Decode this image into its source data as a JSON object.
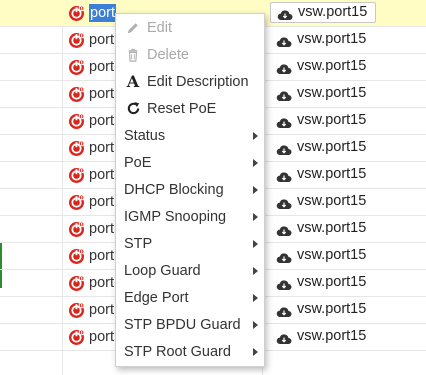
{
  "rows": [
    {
      "port": "port",
      "selected": true,
      "vsw": "vsw.port15"
    },
    {
      "port": "port",
      "vsw": "vsw.port15"
    },
    {
      "port": "port",
      "vsw": "vsw.port15"
    },
    {
      "port": "port",
      "vsw": "vsw.port15"
    },
    {
      "port": "port",
      "vsw": "vsw.port15"
    },
    {
      "port": "port",
      "vsw": "vsw.port15"
    },
    {
      "port": "port",
      "vsw": "vsw.port15"
    },
    {
      "port": "port",
      "vsw": "vsw.port15"
    },
    {
      "port": "port",
      "vsw": "vsw.port15"
    },
    {
      "port": "port",
      "vsw": "vsw.port15"
    },
    {
      "port": "port",
      "vsw": "vsw.port15"
    },
    {
      "port": "port",
      "vsw": "vsw.port15"
    },
    {
      "port": "port",
      "vsw": "vsw.port15"
    }
  ],
  "menu": {
    "items": [
      {
        "label": "Edit",
        "icon": "pencil-icon",
        "disabled": true
      },
      {
        "label": "Delete",
        "icon": "trash-icon",
        "disabled": true
      },
      {
        "label": "Edit Description",
        "icon": "text-icon"
      },
      {
        "label": "Reset PoE",
        "icon": "refresh-icon"
      },
      {
        "label": "Status",
        "submenu": true
      },
      {
        "label": "PoE",
        "submenu": true
      },
      {
        "label": "DHCP Blocking",
        "submenu": true
      },
      {
        "label": "IGMP Snooping",
        "submenu": true
      },
      {
        "label": "STP",
        "submenu": true
      },
      {
        "label": "Loop Guard",
        "submenu": true
      },
      {
        "label": "Edge Port",
        "submenu": true
      },
      {
        "label": "STP BPDU Guard",
        "submenu": true
      },
      {
        "label": "STP Root Guard",
        "submenu": true
      }
    ]
  },
  "colors": {
    "selected_row_bg": "#fffcc4",
    "port_icon_red": "#d9261c",
    "highlight": "#3d7fd6",
    "disabled_text": "#a9a9a9"
  }
}
